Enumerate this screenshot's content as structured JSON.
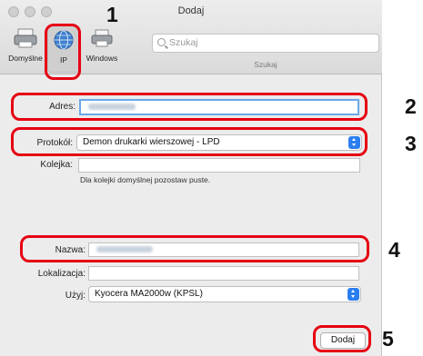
{
  "window": {
    "title": "Dodaj"
  },
  "toolbar": {
    "default_label": "Domyślne",
    "ip_label": "IP",
    "windows_label": "Windows",
    "search_placeholder": "Szukaj",
    "search_caption": "Szukaj"
  },
  "form": {
    "address_label": "Adres:",
    "protocol_label": "Protokół:",
    "protocol_value": "Demon drukarki wierszowej - LPD",
    "queue_label": "Kolejka:",
    "queue_note": "Dla kolejki domyślnej pozostaw puste.",
    "name_label": "Nazwa:",
    "location_label": "Lokalizacja:",
    "use_label": "Użyj:",
    "use_value": "Kyocera MA2000w (KPSL)",
    "add_button": "Dodaj"
  },
  "callouts": [
    "1",
    "2",
    "3",
    "4",
    "5"
  ],
  "colors": {
    "callout": "#e60012",
    "accent": "#2b7ef0"
  }
}
